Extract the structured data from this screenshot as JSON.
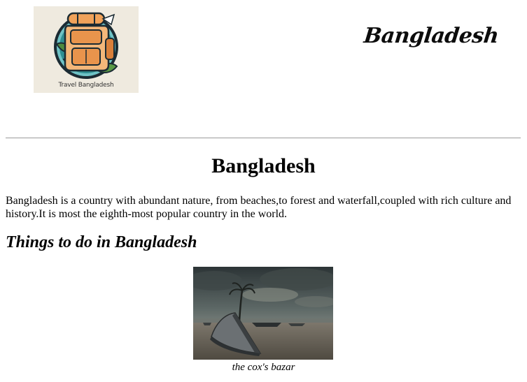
{
  "header": {
    "logo_caption": "Travel Bangladesh",
    "brand_title": "Bangladesh"
  },
  "main": {
    "title": "Bangladesh",
    "intro": "Bangladesh is a country with abundant nature, from beaches,to forest and waterfall,coupled with rich culture and history.It is most the eighth-most popular country in the world.",
    "section_heading": "Things to do in Bangladesh",
    "figure": {
      "icon": "beach-boat-photo",
      "caption": "the cox's bazar"
    }
  },
  "colors": {
    "logo_bg": "#efeadf",
    "logo_circle": "#1f7f86",
    "backpack": "#f0a25a",
    "divider": "#9a9a9a"
  }
}
